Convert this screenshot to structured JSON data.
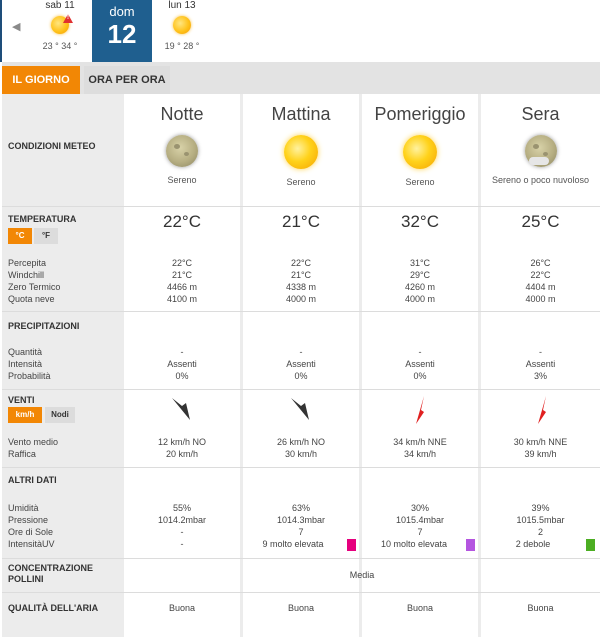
{
  "day_strip": {
    "prev_arrow": "◀",
    "prev_day": {
      "label": "sab 11",
      "temps": "23 ° 34 °"
    },
    "current_day": {
      "name": "dom",
      "number": "12"
    },
    "next_day": {
      "label": "lun 13",
      "temps": "19 ° 28 °"
    }
  },
  "tabs": [
    {
      "label": "IL GIORNO"
    },
    {
      "label": "ORA PER ORA"
    }
  ],
  "periods": [
    {
      "name": "Notte",
      "icon": "moon-icon",
      "condition": "Sereno"
    },
    {
      "name": "Mattina",
      "icon": "sun-icon",
      "condition": "Sereno"
    },
    {
      "name": "Pomeriggio",
      "icon": "sun-icon",
      "condition": "Sereno"
    },
    {
      "name": "Sera",
      "icon": "moon-cloud-icon",
      "condition": "Sereno o poco nuvoloso"
    }
  ],
  "sections": {
    "conditions": "CONDIZIONI METEO",
    "temperature": "TEMPERATURA",
    "precipitation": "PRECIPITAZIONI",
    "winds": "VENTI",
    "other": "ALTRI DATI",
    "pollen": "CONCENTRAZIONE POLLINI",
    "air": "QUALITÀ DELL'ARIA"
  },
  "units": {
    "celsius": "°C",
    "fahrenheit": "°F",
    "kmh": "km/h",
    "knots": "Nodi"
  },
  "temperature": {
    "labels": [
      "Percepita",
      "Windchill",
      "Zero Termico",
      "Quota neve"
    ],
    "main": [
      "22°C",
      "21°C",
      "32°C",
      "25°C"
    ],
    "rows": [
      [
        "22°C",
        "21°C",
        "4466 m",
        "4100 m"
      ],
      [
        "22°C",
        "21°C",
        "4338 m",
        "4000 m"
      ],
      [
        "31°C",
        "29°C",
        "4260 m",
        "4000 m"
      ],
      [
        "26°C",
        "22°C",
        "4404 m",
        "4000 m"
      ]
    ]
  },
  "precipitation": {
    "labels": [
      "Quantità",
      "Intensità",
      "Probabilità"
    ],
    "rows": [
      [
        "-",
        "Assenti",
        "0%"
      ],
      [
        "-",
        "Assenti",
        "0%"
      ],
      [
        "-",
        "Assenti",
        "0%"
      ],
      [
        "-",
        "Assenti",
        "3%"
      ]
    ]
  },
  "wind": {
    "labels": [
      "Vento medio",
      "Raffica"
    ],
    "arrow_colors": [
      "#333333",
      "#333333",
      "#e02020",
      "#e02020"
    ],
    "rows": [
      [
        "12 km/h  NO",
        "20 km/h"
      ],
      [
        "26 km/h NO",
        "30 km/h"
      ],
      [
        "34 km/h NNE",
        "34 km/h"
      ],
      [
        "30 km/h NNE",
        "39 km/h"
      ]
    ]
  },
  "other": {
    "labels": [
      "Umidità",
      "Pressione",
      "Ore di Sole",
      "IntensitàUV"
    ],
    "rows": [
      [
        "55%",
        "1014.2mbar",
        "-",
        "-"
      ],
      [
        "63%",
        "1014.3mbar",
        "7",
        "9 molto elevata"
      ],
      [
        "30%",
        "1015.4mbar",
        "7",
        "10 molto elevata"
      ],
      [
        "39%",
        "1015.5mbar",
        "2",
        "2 debole"
      ]
    ],
    "uv_colors": [
      "",
      "#e6007e",
      "#b455e0",
      "#4cae22"
    ]
  },
  "pollen_value": "Media",
  "air_quality": [
    "Buona",
    "Buona",
    "Buona",
    "Buona"
  ],
  "colors": {
    "accent": "#f28705",
    "current_day_bg": "#1f5f8f"
  }
}
